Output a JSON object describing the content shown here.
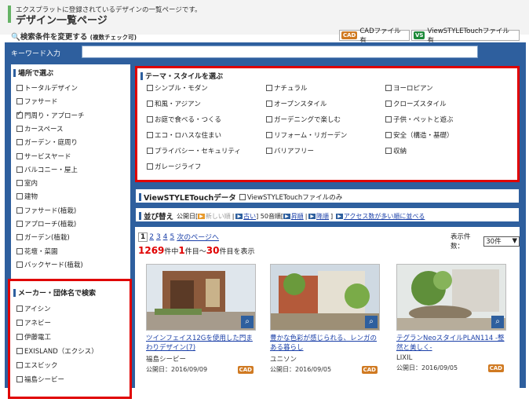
{
  "header": {
    "intro": "エクスプラットに登録されているデザインの一覧ページです。",
    "title": "デザイン一覧ページ",
    "search_heading": "検索条件を変更する",
    "search_sub": "(複数チェック可)",
    "legend_cad_badge": "CAD",
    "legend_cad": "CADファイル有",
    "legend_vs_badge": "VS",
    "legend_vs": "ViewSTYLETouchファイル有"
  },
  "keyword": {
    "label": "キーワード入力",
    "value": ""
  },
  "place": {
    "title": "場所で選ぶ",
    "items": [
      {
        "label": "トータルデザイン",
        "checked": false
      },
      {
        "label": "ファサード",
        "checked": false
      },
      {
        "label": "門周り・アプローチ",
        "checked": true
      },
      {
        "label": "カースペース",
        "checked": false
      },
      {
        "label": "ガーデン・庭周り",
        "checked": false
      },
      {
        "label": "サービスヤード",
        "checked": false
      },
      {
        "label": "バルコニー・屋上",
        "checked": false
      },
      {
        "label": "室内",
        "checked": false
      },
      {
        "label": "建物",
        "checked": false
      },
      {
        "label": "ファサード(植栽)",
        "checked": false
      },
      {
        "label": "アプローチ(植栽)",
        "checked": false
      },
      {
        "label": "ガーデン(植栽)",
        "checked": false
      },
      {
        "label": "花壇・菜園",
        "checked": false
      },
      {
        "label": "バックヤード(植栽)",
        "checked": false
      }
    ]
  },
  "maker": {
    "title": "メーカー・団体名で検索",
    "items": [
      "アイシン",
      "アネビー",
      "伊藤電工",
      "EXISLAND（エクシス）",
      "エスビック",
      "福島シービー"
    ]
  },
  "theme": {
    "title": "テーマ・スタイルを選ぶ",
    "items": [
      "シンプル・モダン",
      "ナチュラル",
      "ヨーロピアン",
      "和風・アジアン",
      "オープンスタイル",
      "クローズスタイル",
      "お庭で食べる・つくる",
      "ガーデニングで楽しむ",
      "子供・ペットと遊ぶ",
      "エコ・ロハスな住まい",
      "リフォーム・リガーデン",
      "安全（構造・基礎）",
      "プライバシー・セキュリティ",
      "バリアフリー",
      "収納",
      "ガレージライフ"
    ]
  },
  "viewstyle": {
    "title": "ViewSTYLETouchデータ",
    "option": "ViewSTYLETouchファイルのみ"
  },
  "sort": {
    "title": "並び替え",
    "label_prefix": "公開日[",
    "newest": "新しい順",
    "sep": "|",
    "oldest": "古い",
    "kana_prefix": "] 50音順[",
    "asc": "昇順",
    "desc": "降順",
    "access_close": "]",
    "access": "アクセス数が多い順に並べる"
  },
  "pager": {
    "pages": [
      "1",
      "2",
      "3",
      "4",
      "5"
    ],
    "next": "次のページへ",
    "per_page_label": "表示件数：",
    "per_page_value": "30件"
  },
  "count": {
    "total": "1269",
    "total_suffix": "件中",
    "from": "1",
    "from_suffix": "件目～",
    "to": "30",
    "to_suffix": "件目を表示"
  },
  "cards": [
    {
      "caption": "ツインフェイス12Gを使用した門まわりデザイン(7)",
      "maker": "福島シービー",
      "date": "公開日：2016/09/09",
      "cad": "CAD"
    },
    {
      "caption": "豊かな色彩が感じられる、レンガのある暮らし",
      "maker": "ユニソン",
      "date": "公開日：2016/09/05",
      "cad": "CAD"
    },
    {
      "caption": "テグランNeoスタイルPLAN114 -整然と美しく-",
      "maker": "LIXIL",
      "date": "公開日：2016/09/05",
      "cad": "CAD"
    }
  ],
  "colors": {
    "panel_blue": "#2e5f9e",
    "highlight_red": "#e00000",
    "cad_orange": "#d07a22",
    "vs_green": "#1e8a3a"
  }
}
